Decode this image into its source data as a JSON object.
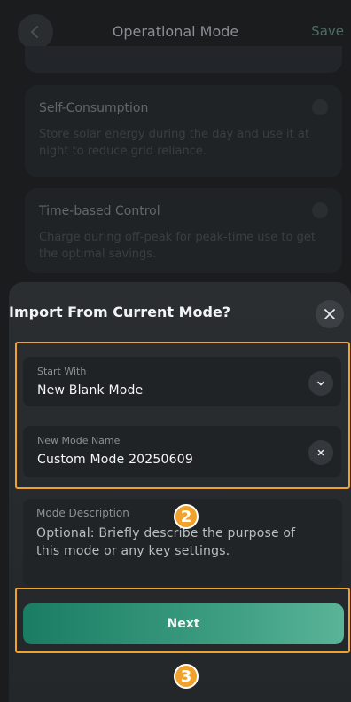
{
  "background": {
    "title": "Operational Mode",
    "save_label": "Save",
    "strip_text": "",
    "cards": [
      {
        "title": "Self-Consumption",
        "description": "Store solar energy during the day and use it at night to reduce grid reliance."
      },
      {
        "title": "Time-based Control",
        "description": "Charge during off-peak for peak-time use to get the optimal savings."
      }
    ]
  },
  "sheet": {
    "title": "Import From Current Mode?",
    "start_with": {
      "label": "Start With",
      "value": "New Blank Mode"
    },
    "mode_name": {
      "label": "New Mode Name",
      "value": "Custom Mode 20250609"
    },
    "description": {
      "label": "Mode Description",
      "placeholder": "Optional: Briefly describe the purpose of this mode or any key settings."
    },
    "next_label": "Next"
  },
  "annotations": {
    "step_2": "2",
    "step_3": "3",
    "highlight_color": "#f0a22c"
  },
  "colors": {
    "accent": "#2a8f72",
    "sheet_bg": "#2a2e31",
    "field_bg": "#202326"
  }
}
